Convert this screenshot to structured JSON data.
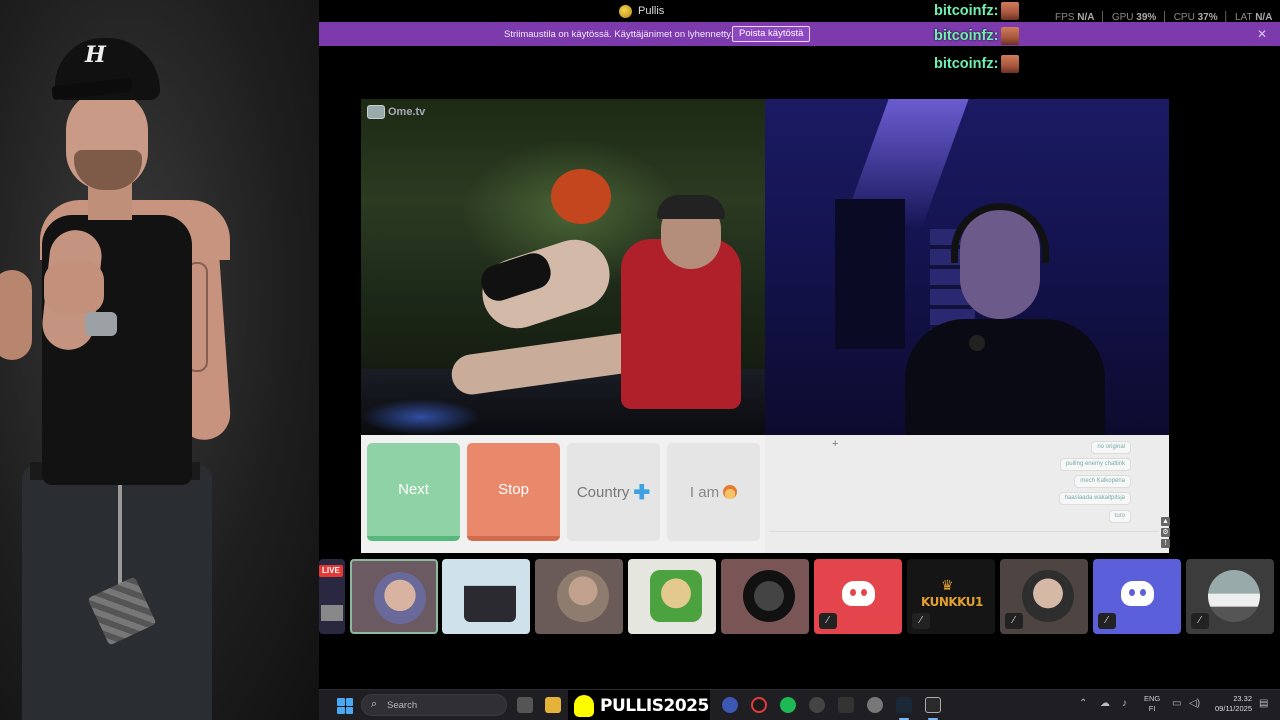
{
  "window": {
    "title": "Pullis",
    "stats": {
      "fps_label": "FPS",
      "fps": "N/A",
      "gpu_label": "GPU",
      "gpu": "39%",
      "cpu_label": "CPU",
      "cpu": "37%",
      "lat_label": "LAT",
      "lat": "N/A"
    }
  },
  "banner": {
    "text": "Striimaustila on käytössä. Käyttäjänimet on lyhennetty.",
    "button": "Poista käytöstä",
    "close": "✕"
  },
  "stream_chat": [
    {
      "user": "bitcoinfz:"
    },
    {
      "user": "bitcoinfz:"
    },
    {
      "user": "bitcoinfz:"
    }
  ],
  "ometv": {
    "logo": "Ome.tv",
    "buttons": {
      "next": "Next",
      "stop": "Stop",
      "country": "Country",
      "i_am": "I am"
    },
    "chat_messages": [
      "no original",
      "pulling enemy chatlink",
      "mech Kalkopena",
      "haaslaada wakaitpitsja",
      "turo"
    ],
    "colors": {
      "next": "#8fd2a5",
      "stop": "#e9886a"
    }
  },
  "voice_tiles": [
    {
      "name": "tile-live",
      "badge": "LIVE"
    },
    {
      "name": "tile-user-1"
    },
    {
      "name": "tile-user-2"
    },
    {
      "name": "tile-user-3"
    },
    {
      "name": "tile-user-4"
    },
    {
      "name": "tile-user-5"
    },
    {
      "name": "tile-discord-red",
      "muted": true
    },
    {
      "name": "tile-kunkku",
      "label": "KUNKKU1",
      "muted": true
    },
    {
      "name": "tile-user-6",
      "muted": true
    },
    {
      "name": "tile-discord-blue",
      "muted": true
    },
    {
      "name": "tile-car",
      "muted": true
    }
  ],
  "taskbar": {
    "search_placeholder": "Search",
    "pinned_text": "PULLIS2025",
    "language": {
      "top": "ENG",
      "bottom": "FI"
    },
    "clock": {
      "time": "23.32",
      "date": "09/11/2025"
    }
  }
}
